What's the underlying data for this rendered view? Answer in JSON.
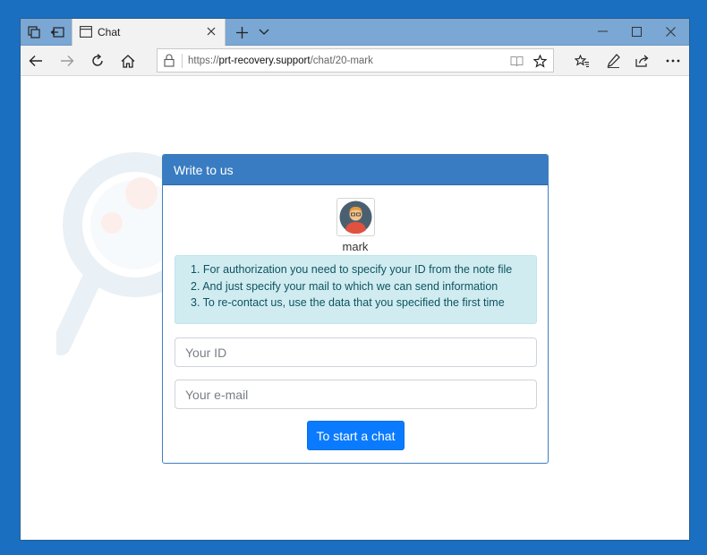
{
  "browser": {
    "tab_title": "Chat",
    "url_prefix": "https://",
    "url_host": "prt-recovery.support",
    "url_path": "/chat/20-mark"
  },
  "chat": {
    "header": "Write to us",
    "username": "mark",
    "instructions": [
      "1. For authorization you need to specify your ID from the note file",
      "2. And just specify your mail to which we can send information",
      "3. To re-contact us, use the data that you specified the first time"
    ],
    "id_placeholder": "Your ID",
    "email_placeholder": "Your e-mail",
    "submit_label": "To start a chat"
  },
  "colors": {
    "desktop": "#1a6fc0",
    "tab_strip": "#7aa7d3",
    "card_header": "#3a7cc2",
    "button": "#0a7bff",
    "info_bg": "#d1ecf1",
    "info_text": "#0c5460"
  },
  "icons": [
    "tab-manager-icon",
    "set-aside-tabs-icon",
    "page-icon",
    "close-icon",
    "plus-icon",
    "chevron-down-icon",
    "minimize-icon",
    "maximize-icon",
    "back-icon",
    "forward-icon",
    "refresh-icon",
    "home-icon",
    "lock-icon",
    "reading-view-icon",
    "favorite-star-icon",
    "favorites-list-icon",
    "pen-icon",
    "share-icon",
    "more-icon"
  ]
}
